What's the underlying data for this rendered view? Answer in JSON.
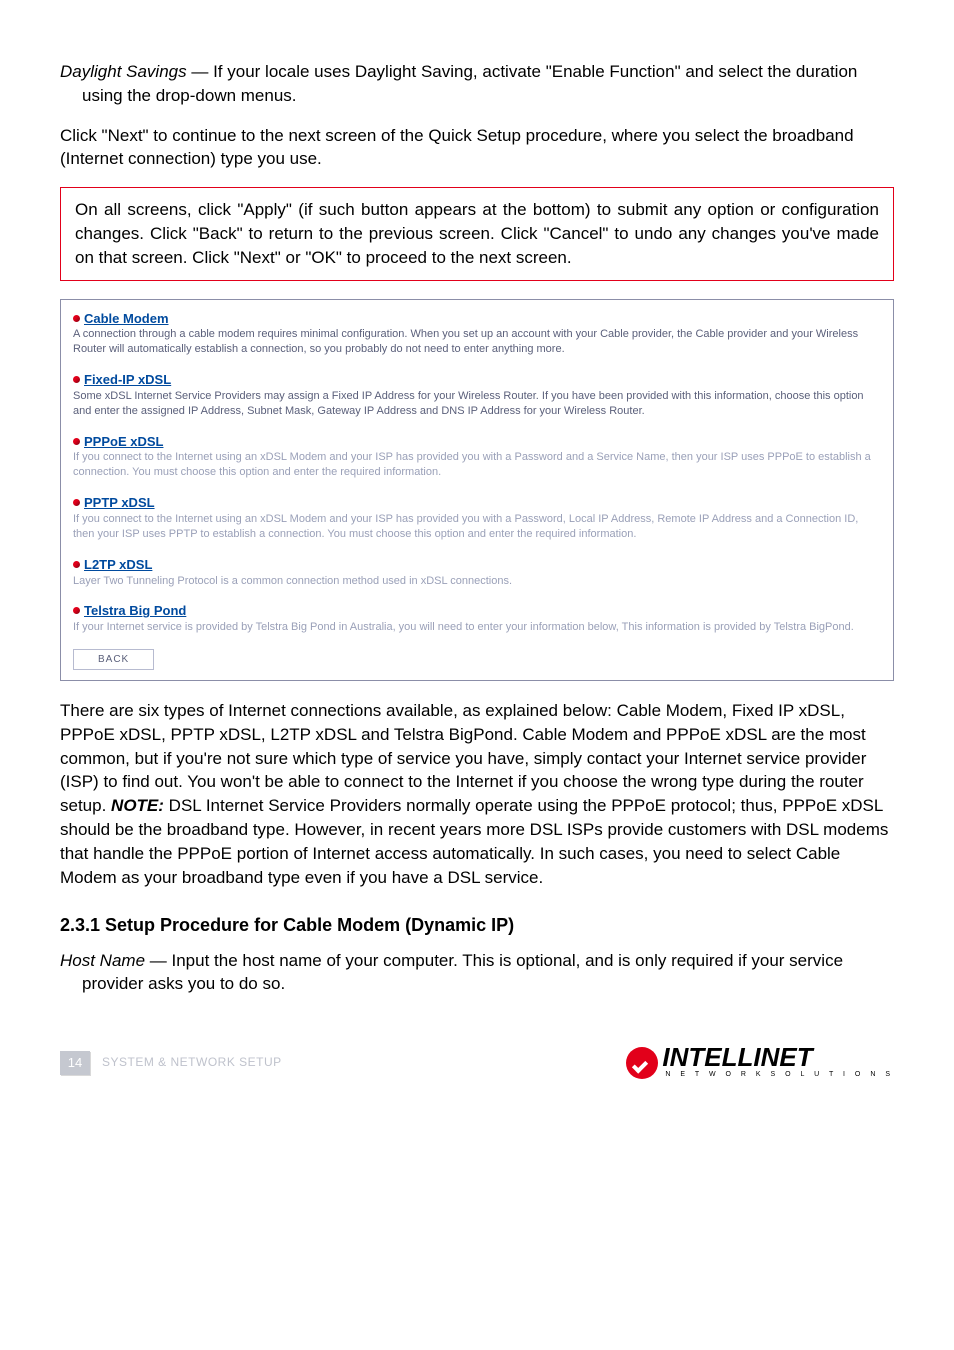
{
  "daylight": {
    "term": "Daylight Savings",
    "sep": " — ",
    "text": "If your locale uses Daylight Saving, activate \"Enable Function\" and select the duration using the drop-down menus."
  },
  "clickNext": "Click \"Next\" to continue to the next screen of the Quick Setup procedure, where you select the broadband (Internet connection) type you use.",
  "noteBox": "On all screens, click \"Apply\" (if such button appears at the bottom) to submit any option or configuration changes. Click \"Back\" to return to the previous screen. Click \"Cancel\" to undo any changes you've made on that screen. Click \"Next\" or \"OK\" to proceed to the next screen.",
  "router": {
    "items": [
      {
        "title": "Cable Modem",
        "desc": "A connection through a cable modem requires minimal configuration. When you set up an account with your Cable provider, the Cable provider and your Wireless Router will automatically establish a connection, so you probably do not need to enter anything more."
      },
      {
        "title": "Fixed-IP xDSL",
        "desc": "Some xDSL Internet Service Providers may assign a Fixed IP Address for your Wireless Router. If you have been provided with this information, choose this option and enter the assigned IP Address, Subnet Mask, Gateway IP Address and DNS IP Address for your Wireless Router."
      },
      {
        "title": "PPPoE xDSL",
        "desc": "If you connect to the Internet using an xDSL Modem and your ISP has provided you with a Password and a Service Name, then your ISP uses PPPoE to establish a connection. You must choose this option and enter the required information."
      },
      {
        "title": "PPTP xDSL",
        "desc": "If you connect to the Internet using an xDSL Modem and your ISP has provided you with a Password, Local IP Address, Remote IP Address and a Connection ID, then your ISP uses PPTP to establish a connection. You must choose this option and enter the required information."
      },
      {
        "title": "L2TP xDSL",
        "desc": "Layer Two Tunneling Protocol is a common connection method used in xDSL connections."
      },
      {
        "title": "Telstra Big Pond",
        "desc": "If your Internet service is provided by Telstra Big Pond in Australia, you will need to enter your information below, This information is provided by Telstra BigPond."
      }
    ],
    "backLabel": "BACK"
  },
  "afterRouter": {
    "p1a": "There are six types of Internet connections available, as explained below: Cable Modem, Fixed IP xDSL, PPPoE xDSL, PPTP xDSL, L2TP xDSL and Telstra BigPond. Cable Modem and PPPoE xDSL are the most common, but if you're not sure which type of service you have, simply contact your Internet service provider (ISP) to find out. You won't be able to connect to the Internet if you choose the wrong type during the router setup. ",
    "noteLabel": "NOTE:",
    "p1b": " DSL Internet Service Providers normally operate using the PPPoE protocol; thus, PPPoE xDSL should be the broadband type. However, in recent years more DSL ISPs provide customers with DSL modems that handle the PPPoE portion of Internet access automatically. In such cases, you need to select Cable Modem as your broadband type even if you have a DSL service."
  },
  "sectionHeading": "2.3.1  Setup Procedure for Cable Modem (Dynamic IP)",
  "hostName": {
    "term": "Host Name",
    "sep": " — ",
    "text": "Input the host name of your computer. This is optional, and is only required if your service provider asks you to do so."
  },
  "footer": {
    "pageNum": "14",
    "label": "SYSTEM & NETWORK SETUP",
    "logoMain": "INTELLINET",
    "logoSub": "N E T W O R K   S O L U T I O N S"
  }
}
